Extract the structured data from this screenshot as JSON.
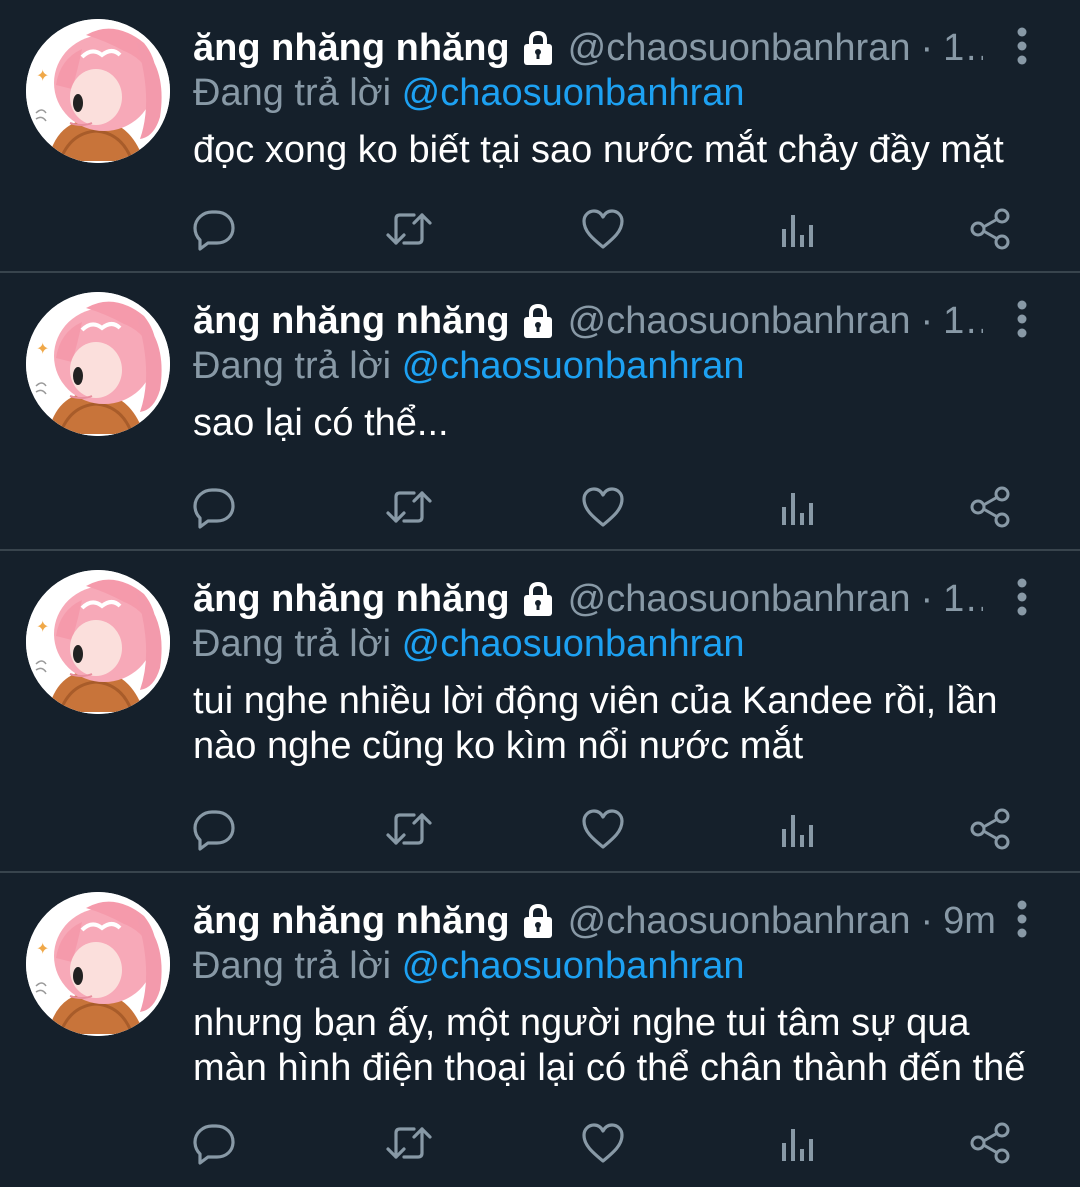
{
  "tweets": [
    {
      "display_name": "ăng nhăng nhăng",
      "handle": "@chaosuonbanhran",
      "separator": "·",
      "time": "1...",
      "reply_prefix": "Đang trả lời",
      "reply_to": "@chaosuonbanhran",
      "text": "đọc xong ko biết tại sao nước mắt chảy đầy mặt"
    },
    {
      "display_name": "ăng nhăng nhăng",
      "handle": "@chaosuonbanhran",
      "separator": "·",
      "time": "1...",
      "reply_prefix": "Đang trả lời",
      "reply_to": "@chaosuonbanhran",
      "text": "sao lại có thể..."
    },
    {
      "display_name": "ăng nhăng nhăng",
      "handle": "@chaosuonbanhran",
      "separator": "·",
      "time": "1...",
      "reply_prefix": "Đang trả lời",
      "reply_to": "@chaosuonbanhran",
      "text": "tui nghe nhiều lời động viên của Kandee rồi, lần nào nghe cũng ko kìm nổi nước mắt"
    },
    {
      "display_name": "ăng nhăng nhăng",
      "handle": "@chaosuonbanhran",
      "separator": "·",
      "time": "9m",
      "reply_prefix": "Đang trả lời",
      "reply_to": "@chaosuonbanhran",
      "text": "nhưng bạn ấy, một người nghe tui tâm sự qua màn hình điện thoại lại có thể chân thành đến thế"
    }
  ],
  "icons": {
    "lock": "lock-icon",
    "more": "more-vertical-icon",
    "reply": "reply-icon",
    "retweet": "retweet-icon",
    "like": "heart-icon",
    "views": "views-icon",
    "share": "share-icon"
  },
  "colors": {
    "background": "#15202b",
    "divider": "#38444d",
    "text_primary": "#ffffff",
    "text_secondary": "#8899a6",
    "accent": "#1da1f2",
    "icon": "#8899a6"
  }
}
